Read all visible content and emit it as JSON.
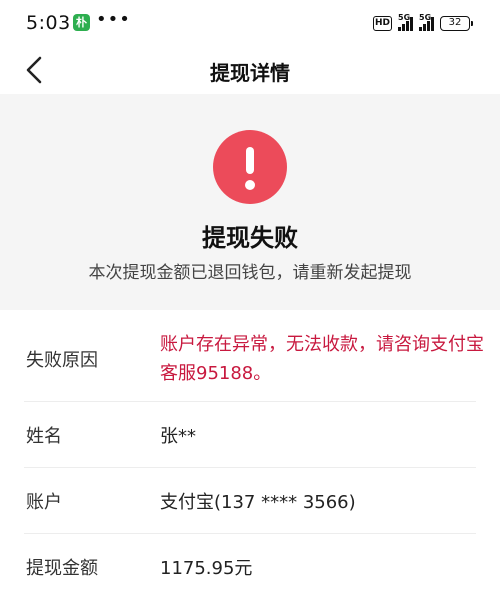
{
  "status_bar": {
    "time": "5:03",
    "app_badge": "朴",
    "dots": "•••",
    "hd": "HD",
    "net1": "5G",
    "net2": "5G",
    "battery": "32"
  },
  "nav": {
    "title": "提现详情",
    "back_icon": "chevron-left-icon"
  },
  "hero": {
    "icon": "exclamation-icon",
    "icon_color": "#ec4b5a",
    "title": "提现失败",
    "subtitle": "本次提现金额已退回钱包，请重新发起提现"
  },
  "details": [
    {
      "label": "失败原因",
      "value": "账户存在异常，无法收款，请咨询支付宝客服95188。"
    },
    {
      "label": "姓名",
      "value": "张**"
    },
    {
      "label": "账户",
      "value": "支付宝(137 **** 3566)"
    },
    {
      "label": "提现金额",
      "value": "1175.95元"
    }
  ],
  "colors": {
    "error_text": "#c8193f",
    "hero_bg": "#f5f5f5"
  }
}
